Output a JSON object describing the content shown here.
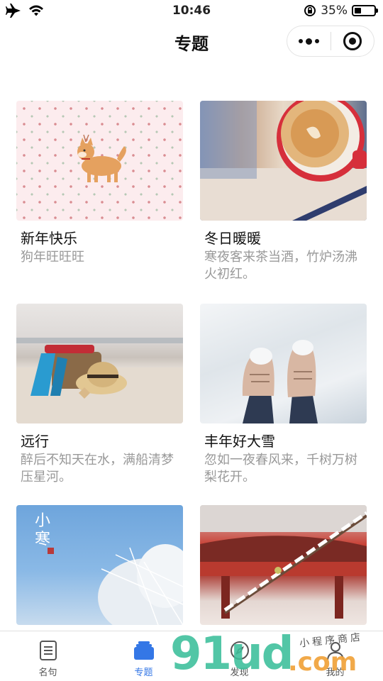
{
  "status": {
    "time": "10:46",
    "battery_text": "35%",
    "battery_level": 0.35
  },
  "nav": {
    "title": "专题"
  },
  "cards": [
    {
      "title": "新年快乐",
      "desc": "狗年旺旺旺",
      "image": "shiba-dog-pattern"
    },
    {
      "title": "冬日暖暖",
      "desc": "寒夜客来茶当酒，竹炉汤沸火初红。",
      "image": "coffee-cup"
    },
    {
      "title": "远行",
      "desc": "醉后不知天在水，满船清梦压星河。",
      "image": "beach-hat-bag"
    },
    {
      "title": "丰年好大雪",
      "desc": "忽如一夜春风来，千树万树梨花开。",
      "image": "boots-in-snow"
    },
    {
      "title": "",
      "desc": "",
      "image": "frost-tree-sky",
      "overlay_text": "小寒"
    },
    {
      "title": "",
      "desc": "",
      "image": "snowy-branch-pavilion"
    }
  ],
  "tabs": [
    {
      "label": "名句",
      "icon": "document-icon",
      "active": false
    },
    {
      "label": "专题",
      "icon": "stack-icon",
      "active": true
    },
    {
      "label": "发现",
      "icon": "compass-icon",
      "active": false
    },
    {
      "label": "我的",
      "icon": "person-icon",
      "active": false
    }
  ],
  "watermark": {
    "main": "91ud",
    "suffix": ".com",
    "tagline": "小程序商店"
  },
  "colors": {
    "accent": "#3477e6",
    "watermark_green": "#3bbf9a",
    "watermark_orange": "#f0a23a"
  }
}
